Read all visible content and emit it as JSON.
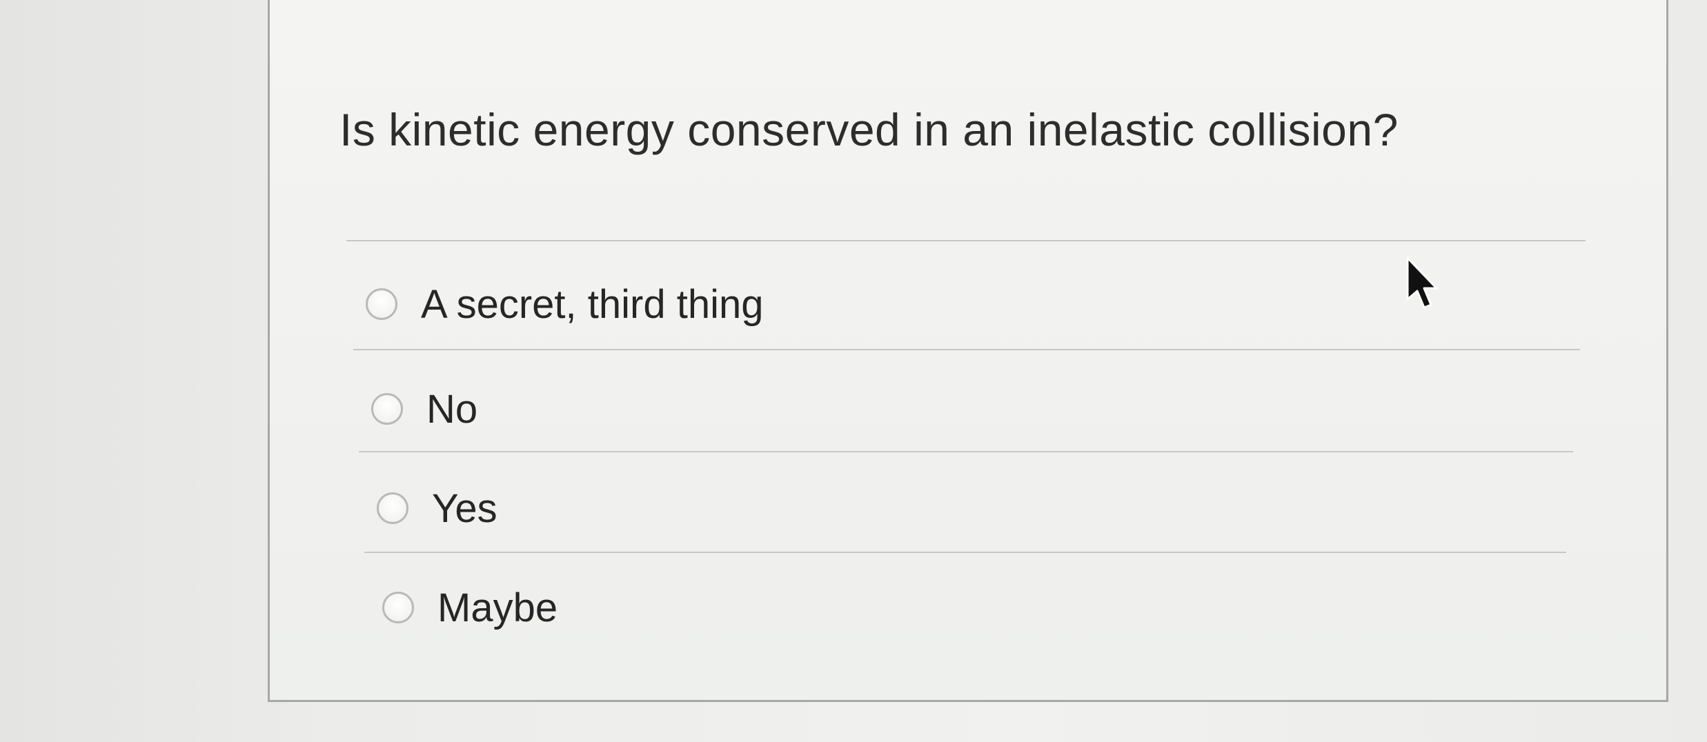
{
  "question": {
    "text": "Is kinetic energy conserved in an inelastic collision?"
  },
  "answers": [
    {
      "label": "A secret, third thing",
      "selected": false
    },
    {
      "label": "No",
      "selected": false
    },
    {
      "label": "Yes",
      "selected": false
    },
    {
      "label": "Maybe",
      "selected": false
    }
  ],
  "cursor": {
    "icon": "mouse-pointer-icon"
  }
}
